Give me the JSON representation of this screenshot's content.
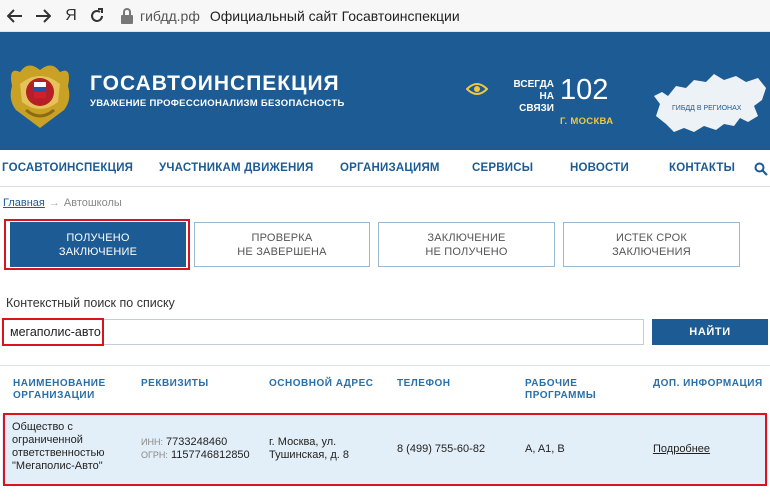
{
  "browser": {
    "back_icon": "arrow-left-icon",
    "forward_icon": "arrow-right-icon",
    "yandex_label": "Я",
    "reload_icon": "reload-icon",
    "domain": "гибдд.рф",
    "page_title": "Официальный сайт Госавтоинспекции"
  },
  "header": {
    "title": "ГОСАВТОИНСПЕКЦИЯ",
    "subtitle": "УВАЖЕНИЕ ПРОФЕССИОНАЛИЗМ БЕЗОПАСНОСТЬ",
    "always_line1": "ВСЕГДА",
    "always_line2": "НА СВЯЗИ",
    "phone": "102",
    "city": "Г. МОСКВА",
    "map_label": "ГИБДД В РЕГИОНАХ",
    "colors": {
      "brand": "#1c5b93",
      "accent": "#f0c93c",
      "highlight": "#d9141e"
    }
  },
  "nav": {
    "items": [
      "ГОСАВТОИНСПЕКЦИЯ",
      "УЧАСТНИКАМ ДВИЖЕНИЯ",
      "ОРГАНИЗАЦИЯМ",
      "СЕРВИСЫ",
      "НОВОСТИ",
      "КОНТАКТЫ"
    ],
    "search_icon": "search-icon"
  },
  "breadcrumb": {
    "home": "Главная",
    "separator": "→",
    "current": "Автошколы"
  },
  "status_tabs": [
    {
      "line1": "ПОЛУЧЕНО",
      "line2": "ЗАКЛЮЧЕНИЕ",
      "active": true
    },
    {
      "line1": "ПРОВЕРКА",
      "line2": "НЕ ЗАВЕРШЕНА",
      "active": false
    },
    {
      "line1": "ЗАКЛЮЧЕНИЕ",
      "line2": "НЕ ПОЛУЧЕНО",
      "active": false
    },
    {
      "line1": "ИСТЕК СРОК",
      "line2": "ЗАКЛЮЧЕНИЯ",
      "active": false
    }
  ],
  "search": {
    "label": "Контекстный поиск по списку",
    "value": "мегаполис-авто",
    "button": "НАЙТИ"
  },
  "table": {
    "headers": [
      {
        "line1": "НАИМЕНОВАНИЕ",
        "line2": "ОРГАНИЗАЦИИ"
      },
      {
        "line1": "РЕКВИЗИТЫ",
        "line2": ""
      },
      {
        "line1": "ОСНОВНОЙ АДРЕС",
        "line2": ""
      },
      {
        "line1": "ТЕЛЕФОН",
        "line2": ""
      },
      {
        "line1": "РАБОЧИЕ",
        "line2": "ПРОГРАММЫ"
      },
      {
        "line1": "ДОП. ИНФОРМАЦИЯ",
        "line2": ""
      }
    ],
    "rows": [
      {
        "name_lines": [
          "Общество с",
          "ограниченной",
          "ответственностью",
          "\"Мегаполис-Авто\""
        ],
        "inn_caption": "ИНН:",
        "inn": "7733248460",
        "ogrn_caption": "ОГРН:",
        "ogrn": "1157746812850",
        "address_lines": [
          "г. Москва, ул.",
          "Тушинская, д. 8"
        ],
        "phone": "8 (499) 755-60-82",
        "programs": "A, A1, B",
        "more": "Подробнее"
      }
    ]
  }
}
